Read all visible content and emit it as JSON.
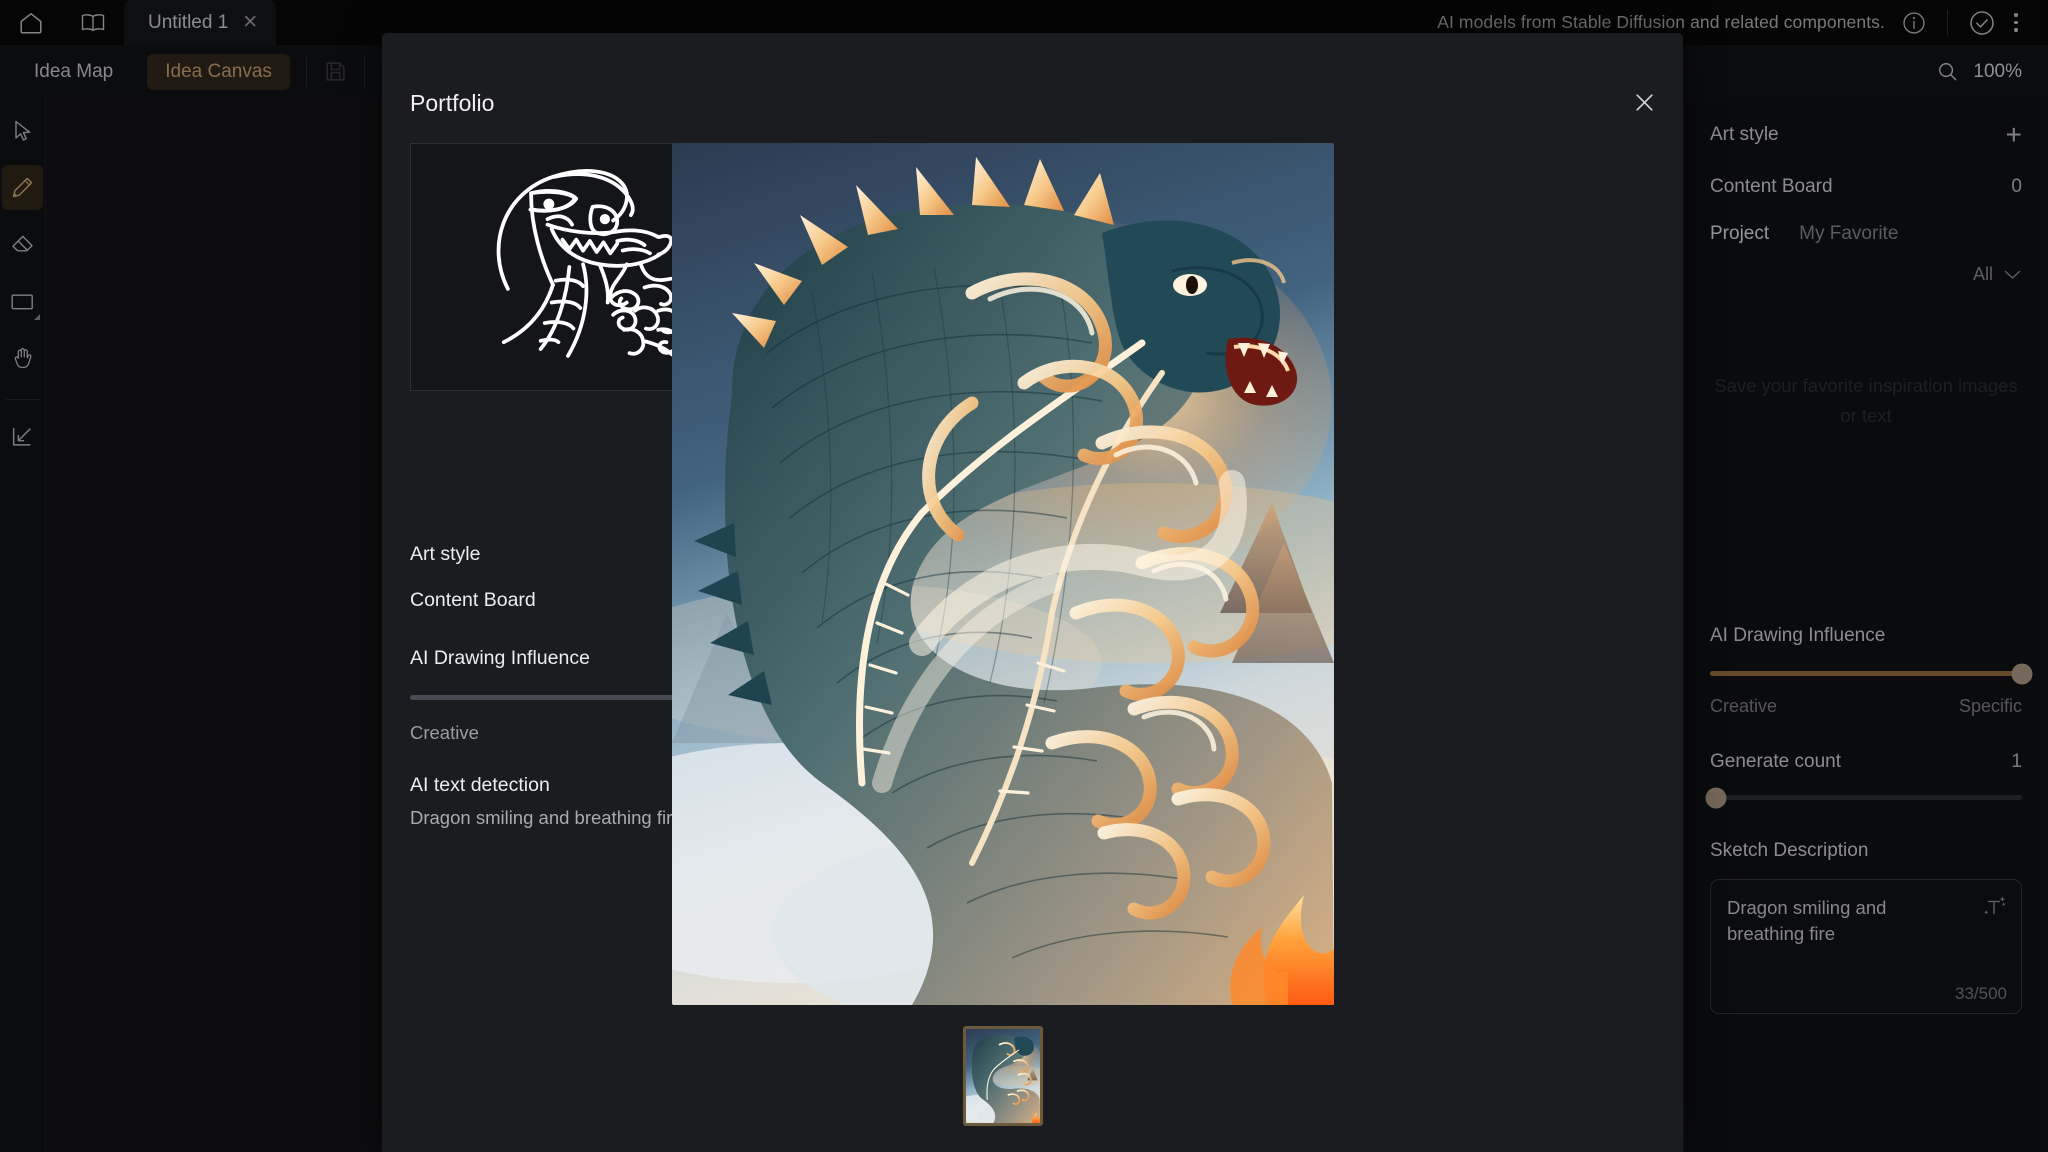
{
  "titlebar": {
    "home_icon": "home-icon",
    "library_icon": "book-icon",
    "tab_label": "Untitled 1",
    "tab_close": "✕",
    "notice": "AI models from Stable Diffusion and related components.",
    "info_icon": "info-circle-icon",
    "check_icon": "check-circle-icon",
    "menu_icon": "more-vertical-icon"
  },
  "toolbar": {
    "idea_map": "Idea Map",
    "idea_canvas": "Idea Canvas",
    "save_icon": "save-disk-icon",
    "search_icon": "magnifier-icon",
    "zoom_level": "100%"
  },
  "tools": [
    {
      "name": "select-tool",
      "icon": "cursor-arrow-icon",
      "active": false
    },
    {
      "name": "pencil-tool",
      "icon": "pencil-icon",
      "active": true
    },
    {
      "name": "eraser-tool",
      "icon": "eraser-icon",
      "active": false
    },
    {
      "name": "shape-tool",
      "icon": "rectangle-icon",
      "active": false
    },
    {
      "name": "pan-tool",
      "icon": "hand-icon",
      "active": false
    },
    {
      "name": "import-tool",
      "icon": "import-arrow-icon",
      "active": false
    }
  ],
  "right_panel": {
    "art_style_label": "Art style",
    "add_icon": "plus-icon",
    "content_board_label": "Content Board",
    "content_board_count": "0",
    "tabs": [
      {
        "label": "Project",
        "active": true
      },
      {
        "label": "My Favorite",
        "active": false
      }
    ],
    "filter_label": "All",
    "filter_icon": "chevron-down-icon",
    "empty_state": "Save your favorite inspiration images or text",
    "influence_label": "AI Drawing Influence",
    "influence_value": 100,
    "influence_min_label": "Creative",
    "influence_max_label": "Specific",
    "generate_count_label": "Generate count",
    "generate_count_value": "1",
    "generate_count_percent": 2,
    "sketch_description_label": "Sketch Description",
    "sketch_description_value": "Dragon smiling and breathing fire",
    "sketch_description_counter": "33/500",
    "magic_text_icon": "magic-text-icon",
    "accent_color": "#9d7441",
    "knob_color": "#b4a08a"
  },
  "modal": {
    "title": "Portfolio",
    "close_icon": "close-icon",
    "sketch_preview_name": "dragon-sketch-thumbnail",
    "meta": {
      "art_style_label": "Art style",
      "art_style_value": "",
      "content_board_label": "Content Board",
      "content_board_value": "0",
      "influence_label": "AI Drawing Influence",
      "influence_min_label": "Creative",
      "influence_max_label": "Specific",
      "text_detection_label": "AI text detection",
      "text_detection_value": "Dragon smiling and breathing fire"
    },
    "preview_image_name": "generated-dragon-image",
    "thumbnails": [
      {
        "name": "result-thumbnail-1",
        "selected": true
      }
    ]
  }
}
